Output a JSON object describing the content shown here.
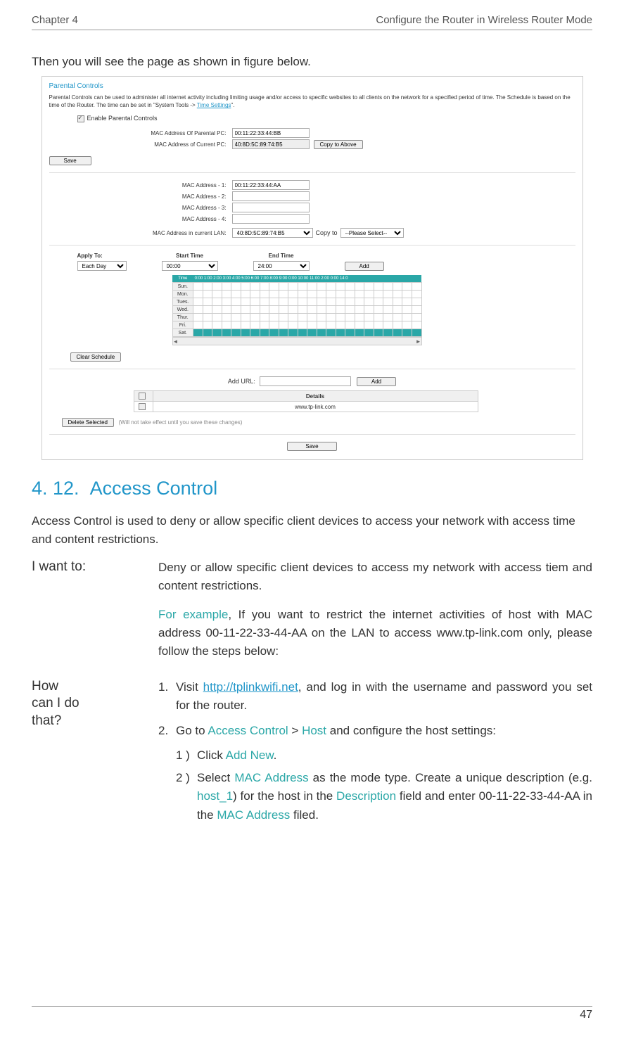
{
  "header": {
    "chapter": "Chapter 4",
    "title": "Configure the Router in Wireless Router Mode"
  },
  "intro": "Then you will see the page as shown in figure below.",
  "ss": {
    "title": "Parental Controls",
    "desc1": "Parental Controls can be used to administer all internet activity including limiting usage and/or access to specific websites to all clients on the network for a specified period of time. The Schedule is based on the time of the Router. The time can be set in \"System Tools -> ",
    "desc1_link": "Time Settings",
    "desc1_end": "\".",
    "enable_label": "Enable Parental Controls",
    "mac_parental_label": "MAC Address Of Parental PC:",
    "mac_parental_val": "00:11:22:33:44:BB",
    "mac_current_label": "MAC Address of Current PC:",
    "mac_current_val": "40:8D:5C:89:74:B5",
    "copy_above": "Copy to Above",
    "save": "Save",
    "mac1_label": "MAC Address - 1:",
    "mac1_val": "00:11:22:33:44:AA",
    "mac2_label": "MAC Address - 2:",
    "mac3_label": "MAC Address - 3:",
    "mac4_label": "MAC Address - 4:",
    "mac_lan_label": "MAC Address in current LAN:",
    "mac_lan_val": "40:8D:5C:89:74:B5",
    "copy_to": "Copy to",
    "please_select": "--Please Select--",
    "apply_to": "Apply To:",
    "each_day": "Each Day",
    "start_time": "Start Time",
    "start_val": "00:00",
    "end_time": "End Time",
    "end_val": "24:00",
    "add": "Add",
    "time_hdr": "Time",
    "hours": "0:00 1:00 2:00 3:00 4:00 5:00 6:00 7:00 8:00 9:00 0:00 10:00 11:00 2:00 0:00 14:0",
    "days": [
      "Sun.",
      "Mon.",
      "Tues.",
      "Wed.",
      "Thur.",
      "Fri.",
      "Sat."
    ],
    "clear_schedule": "Clear Schedule",
    "add_url": "Add URL:",
    "details": "Details",
    "url_row": "www.tp-link.com",
    "delete_selected": "Delete Selected",
    "delete_note": "(Will not take effect until you save these changes)"
  },
  "section": {
    "num": "4. 12.",
    "title": "Access Control"
  },
  "para1": "Access Control is used to deny or allow specific client devices to access your network with access time and content restrictions.",
  "iwant_label": "I want to:",
  "iwant_text": "Deny or allow specific client devices to access my network with access tiem and content restrictions.",
  "example_lead": "For example",
  "example_rest": ", If you want to restrict the internet activities of host with MAC address 00-11-22-33-44-AA on the LAN to access www.tp-link.com only, please follow the steps below:",
  "how_label1": "How",
  "how_label2": "can I do",
  "how_label3": "that?",
  "step1_pre": "Visit ",
  "step1_link": "http://tplinkwifi.net",
  "step1_post": ", and log in with the username and password you set for the router.",
  "step2_pre": "Go to ",
  "step2_a": "Access Control",
  "step2_gt": " > ",
  "step2_b": "Host",
  "step2_post": " and configure the host settings:",
  "sub1_pre": "Click ",
  "sub1_a": "Add New",
  "sub1_post": ".",
  "sub2_pre": "Select ",
  "sub2_a": "MAC Address",
  "sub2_mid1": " as the mode type. Create a unique description (e.g. ",
  "sub2_b": "host_1",
  "sub2_mid2": ") for the host in the ",
  "sub2_c": "Description",
  "sub2_mid3": " field and enter 00-11-22-33-44-AA in the ",
  "sub2_d": "MAC Address",
  "sub2_post": " filed.",
  "pagenum": "47"
}
